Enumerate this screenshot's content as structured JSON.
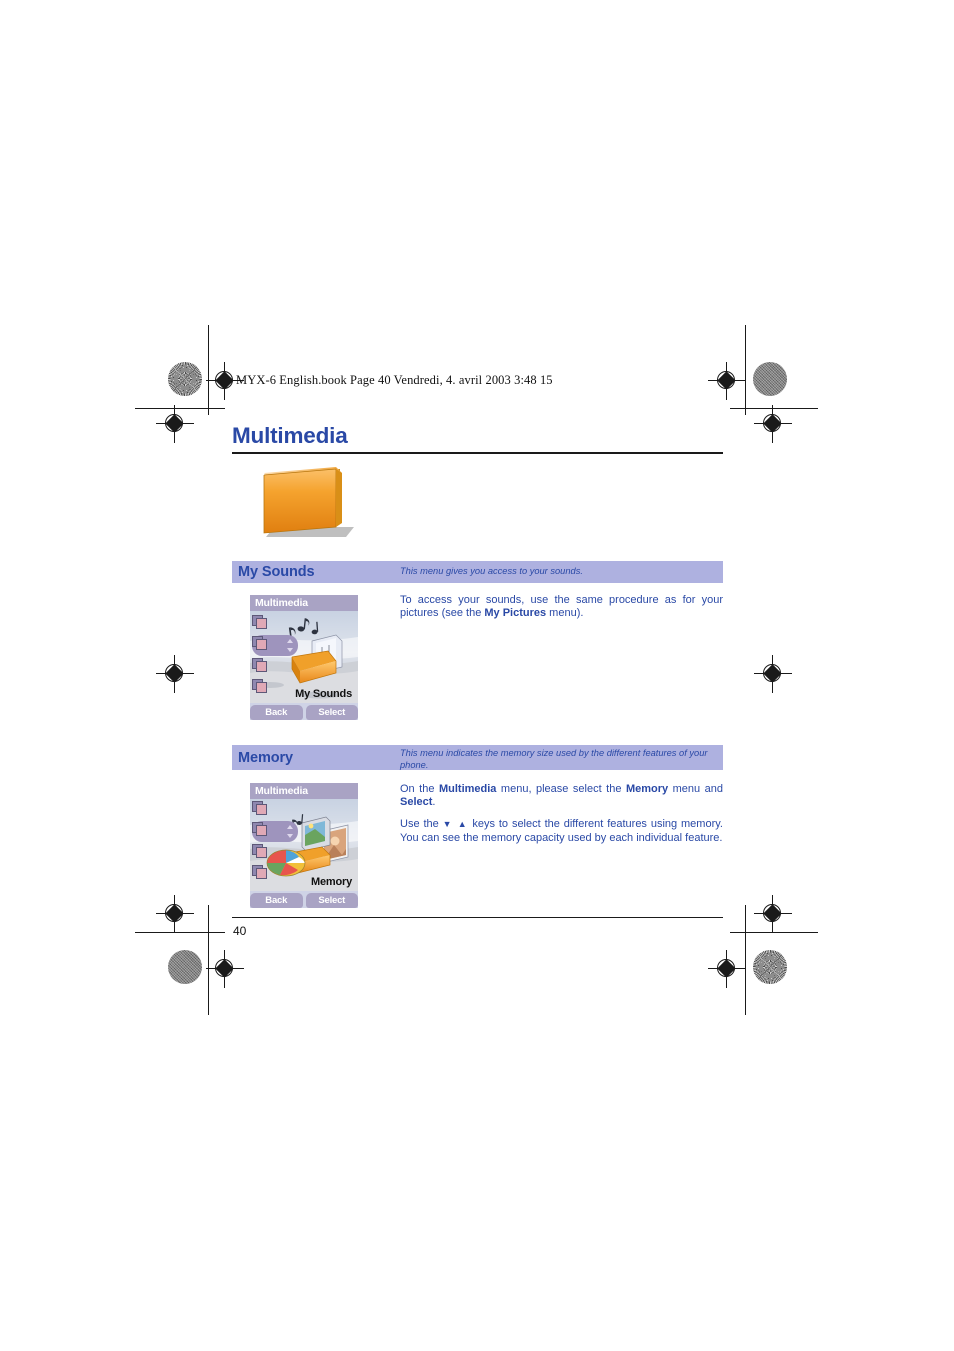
{
  "document": {
    "running_header": "MYX-6 English.book  Page 40  Vendredi, 4. avril 2003  3:48 15",
    "chapter_title": "Multimedia",
    "page_number": "40",
    "colors": {
      "heading_blue": "#2a49a6",
      "section_bar": "#aeb1e0",
      "folder_orange": "#f29a1e",
      "softkey_purple": "#a9a3c4"
    }
  },
  "folder_icon": {
    "name": "multimedia-folder-icon"
  },
  "sections": [
    {
      "id": "my-sounds",
      "title": "My Sounds",
      "description": "This menu gives you access to your sounds.",
      "screenshot": {
        "titlebar": "Multimedia",
        "caption": "My Sounds",
        "softkeys": [
          "Back",
          "Select"
        ],
        "selected_index": 1
      },
      "paragraphs": [
        {
          "runs": [
            {
              "text": "To access your sounds, use the same procedure as for your pictures (see the ",
              "bold": false
            },
            {
              "text": "My Pictures",
              "bold": true
            },
            {
              "text": " menu).",
              "bold": false
            }
          ]
        }
      ]
    },
    {
      "id": "memory",
      "title": "Memory",
      "description": "This menu indicates the memory size used by the different features of your phone.",
      "screenshot": {
        "titlebar": "Multimedia",
        "caption": "Memory",
        "softkeys": [
          "Back",
          "Select"
        ],
        "selected_index": 1
      },
      "paragraphs": [
        {
          "runs": [
            {
              "text": "On the ",
              "bold": false
            },
            {
              "text": "Multimedia",
              "bold": true
            },
            {
              "text": " menu, please select the ",
              "bold": false
            },
            {
              "text": "Memory",
              "bold": true
            },
            {
              "text": " menu and ",
              "bold": false
            },
            {
              "text": "Select",
              "bold": true
            },
            {
              "text": ".",
              "bold": false
            }
          ]
        },
        {
          "runs": [
            {
              "text": "Use the ",
              "bold": false
            },
            {
              "text": "▼ ▲",
              "bold": false,
              "glyph": true
            },
            {
              "text": " keys to select the different features using memory. You can see the memory capacity used by each individual feature.",
              "bold": false
            }
          ]
        }
      ]
    }
  ],
  "print_marks": {
    "registration_label": "registration-target",
    "halftone_label": "halftone-patch"
  }
}
